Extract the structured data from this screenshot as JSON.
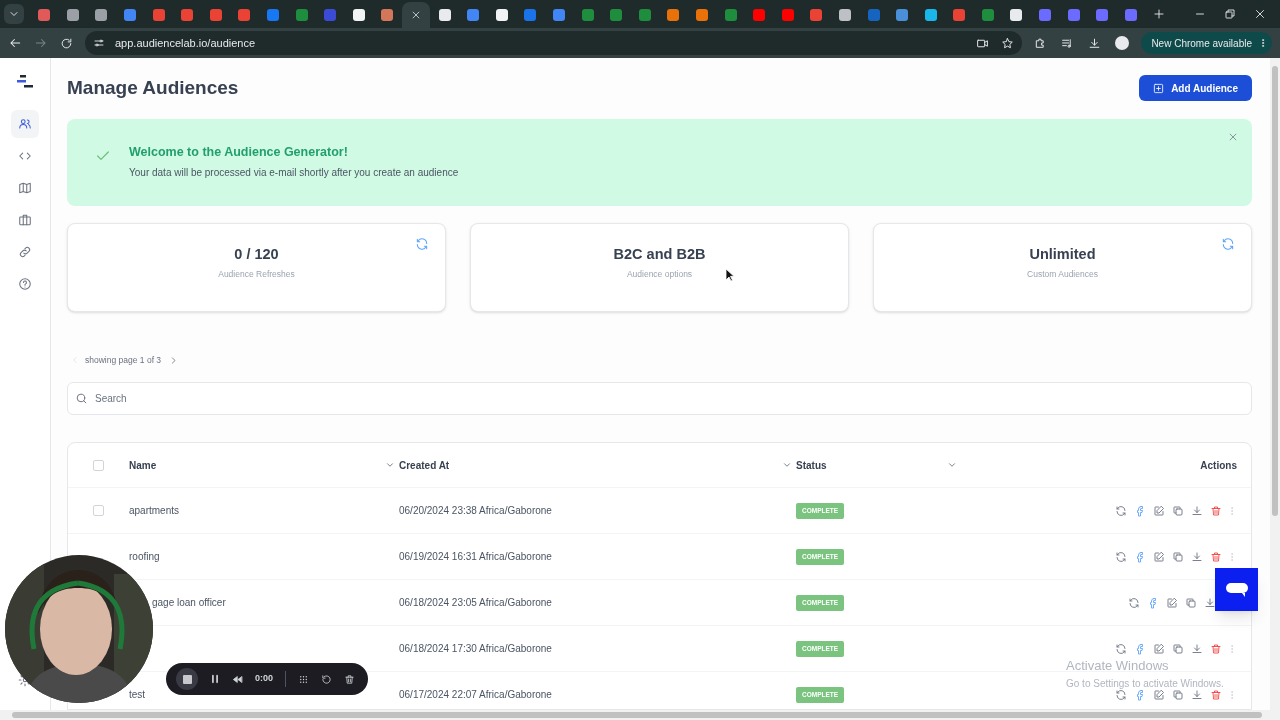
{
  "browser": {
    "tabs": [
      {
        "color": "#e05a5a",
        "selected": false
      },
      {
        "color": "#9aa0a6",
        "selected": false
      },
      {
        "color": "#9aa0a6",
        "selected": false
      },
      {
        "color": "#4285f4",
        "selected": false
      },
      {
        "color": "#ea4335",
        "selected": false
      },
      {
        "color": "#ea4335",
        "selected": false
      },
      {
        "color": "#ea4335",
        "selected": false
      },
      {
        "color": "#ea4335",
        "selected": false
      },
      {
        "color": "#1877f2",
        "selected": false
      },
      {
        "color": "#1e8e3e",
        "selected": false
      },
      {
        "color": "#3c4bd6",
        "selected": false
      },
      {
        "color": "#f1f3f4",
        "selected": false
      },
      {
        "color": "#d4765a",
        "selected": false
      },
      {
        "selected": true
      },
      {
        "color": "#e8eaed",
        "selected": false
      },
      {
        "color": "#4285f4",
        "selected": false
      },
      {
        "color": "#f1f3f4",
        "selected": false
      },
      {
        "color": "#1a73e8",
        "selected": false
      },
      {
        "color": "#4285f4",
        "selected": false
      },
      {
        "color": "#1e8e3e",
        "selected": false
      },
      {
        "color": "#1e8e3e",
        "selected": false
      },
      {
        "color": "#1e8e3e",
        "selected": false
      },
      {
        "color": "#e8710a",
        "selected": false
      },
      {
        "color": "#e8710a",
        "selected": false
      },
      {
        "color": "#1e8e3e",
        "selected": false
      },
      {
        "color": "#ff0000",
        "selected": false
      },
      {
        "color": "#ff0000",
        "selected": false
      },
      {
        "color": "#ea4335",
        "selected": false
      },
      {
        "color": "#bdc1c6",
        "selected": false
      },
      {
        "color": "#1565c0",
        "selected": false
      },
      {
        "color": "#4a90d9",
        "selected": false
      },
      {
        "color": "#1ab7ea",
        "selected": false
      },
      {
        "color": "#ea4335",
        "selected": false
      },
      {
        "color": "#1e8e3e",
        "selected": false
      },
      {
        "color": "#e8eaed",
        "selected": false
      },
      {
        "color": "#6b6bff",
        "selected": false
      },
      {
        "color": "#6b6bff",
        "selected": false
      },
      {
        "color": "#6b6bff",
        "selected": false
      },
      {
        "color": "#6b6bff",
        "selected": false
      }
    ],
    "address": "app.audiencelab.io/audience",
    "update_chip": "New Chrome available"
  },
  "sidebar": {
    "items": [
      {
        "selected": true
      },
      {
        "selected": false
      },
      {
        "selected": false
      },
      {
        "selected": false
      },
      {
        "selected": false
      },
      {
        "selected": false
      }
    ]
  },
  "page": {
    "title": "Manage Audiences",
    "add_button": "Add Audience"
  },
  "alert": {
    "title": "Welcome to the Audience Generator!",
    "message": "Your data will be processed via e-mail shortly after you create an audience"
  },
  "stats": [
    {
      "value": "0 / 120",
      "label": "Audience Refreshes",
      "refreshable": true
    },
    {
      "value": "B2C and B2B",
      "label": "Audience options",
      "refreshable": false
    },
    {
      "value": "Unlimited",
      "label": "Custom Audiences",
      "refreshable": true
    }
  ],
  "pagination": "showing page 1 of 3",
  "search": {
    "placeholder": "Search"
  },
  "table": {
    "columns": [
      "Name",
      "Created At",
      "Status",
      "Actions"
    ],
    "header_checked": false,
    "rows": [
      {
        "checked": false,
        "name": "apartments",
        "created_at": "06/20/2024 23:38 Africa/Gaborone",
        "status": "COMPLETE"
      },
      {
        "name": "roofing",
        "created_at": "06/19/2024 16:31 Africa/Gaborone",
        "status": "COMPLETE"
      },
      {
        "name": "gage loan officer",
        "created_at": "06/18/2024 23:05 Africa/Gaborone",
        "status": "COMPLETE"
      },
      {
        "created_at": "06/18/2024 17:30 Africa/Gaborone",
        "status": "COMPLETE"
      },
      {
        "name": "test",
        "created_at": "06/17/2024 22:07 Africa/Gaborone",
        "status": "COMPLETE"
      }
    ]
  },
  "recorder": {
    "time": "0:00"
  },
  "os_notice": {
    "title": "Activate Windows",
    "message": "Go to Settings to activate Windows."
  }
}
